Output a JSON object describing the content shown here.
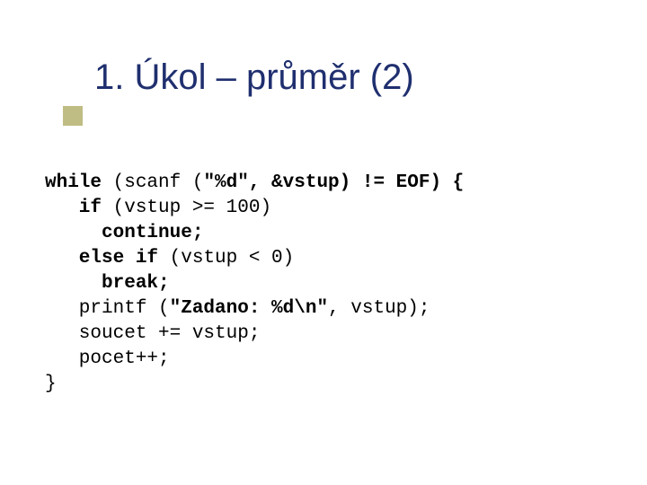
{
  "title": "1. Úkol – průměr (2)",
  "code": {
    "l1a": "while",
    "l1b": " (scanf (",
    "l1c": "\"%d\", &vstup) != EOF) {",
    "l2a": "   if",
    "l2b": " (vstup >= 100)",
    "l3a": "     continue;",
    "l4a": "   else if",
    "l4b": " (vstup < 0)",
    "l5a": "     break;",
    "l6a": "   printf (",
    "l6b": "\"Zadano: %d\\n\"",
    "l6c": ", vstup);",
    "l7a": "   soucet += vstup;",
    "l8a": "   pocet++;",
    "l9a": "}"
  }
}
